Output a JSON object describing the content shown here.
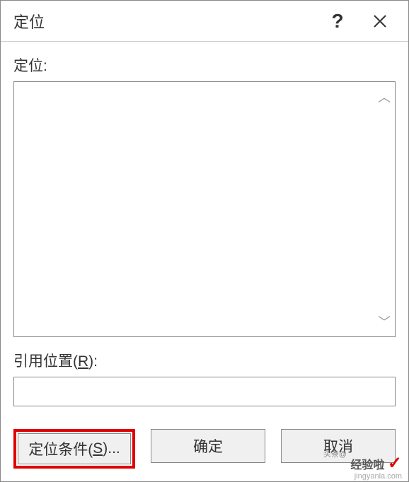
{
  "titlebar": {
    "title": "定位"
  },
  "labels": {
    "goto": "定位:",
    "reference": "引用位置(R):"
  },
  "reference_input": {
    "value": ""
  },
  "buttons": {
    "special": "定位条件(S)...",
    "ok": "确定",
    "cancel": "取消"
  },
  "watermark": {
    "small": "头条@",
    "main": "经验啦",
    "domain": "jingyanla.com"
  }
}
